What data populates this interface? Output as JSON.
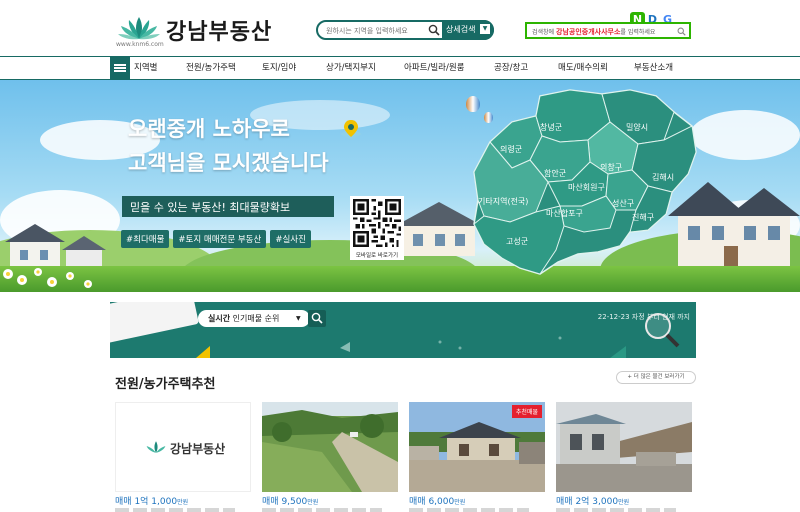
{
  "header": {
    "logo_text": "강남부동산",
    "logo_url": "www.knm6.com",
    "search_placeholder": "원하시는 지역을 입력하세요",
    "search_button": "상세검색",
    "search_caret": "▼",
    "naver_prefix": "검색창에 ",
    "naver_keyword": "강남공인중개사사무소",
    "naver_suffix": "를 입력하세요",
    "ndg": [
      "N",
      "D",
      "G"
    ]
  },
  "nav": {
    "items": [
      "지역별",
      "전원/농가주택",
      "토지/임야",
      "상가/택지부지",
      "아파트/빌라/원룸",
      "공장/창고",
      "매도/매수의뢰",
      "부동산소개"
    ]
  },
  "banner": {
    "headline_1": "오랜중개 노하우로",
    "headline_2": "고객님을 모시겠습니다",
    "sub_text": "믿을 수 있는 부동산! 최대물량확보",
    "tags": [
      "#최다매물",
      "#토지 매매전문 부동산",
      "#실사진"
    ],
    "qr_label": "모바일로 바로가기",
    "map_regions": [
      "창녕군",
      "밀양시",
      "의령군",
      "함안군",
      "의창구",
      "김해시",
      "마산회원구",
      "기타지역(전국)",
      "성산구",
      "진해구",
      "마산합포구",
      "고성군"
    ]
  },
  "ranking": {
    "label_bold": "실시간",
    "label_rest": " 인기매물 순위",
    "caret": "▼",
    "date_text": "22-12-23 자정 부터 현재 까지"
  },
  "section": {
    "title": "전원/농가주택추천",
    "more_button": "+ 더 많은 물건 보러가기"
  },
  "cards": [
    {
      "type": "매매",
      "amount": "1억 1,000",
      "unit": "만원",
      "badge": ""
    },
    {
      "type": "매매",
      "amount": "9,500",
      "unit": "만원",
      "badge": ""
    },
    {
      "type": "매매",
      "amount": "6,000",
      "unit": "만원",
      "badge": "추천매물"
    },
    {
      "type": "매매",
      "amount": "2억 3,000",
      "unit": "만원",
      "badge": ""
    }
  ],
  "colors": {
    "brand": "#176a64",
    "rank_bg": "#1d7a6f",
    "price": "#1e73be",
    "badge": "#e4202e",
    "naver": "#2db400"
  }
}
